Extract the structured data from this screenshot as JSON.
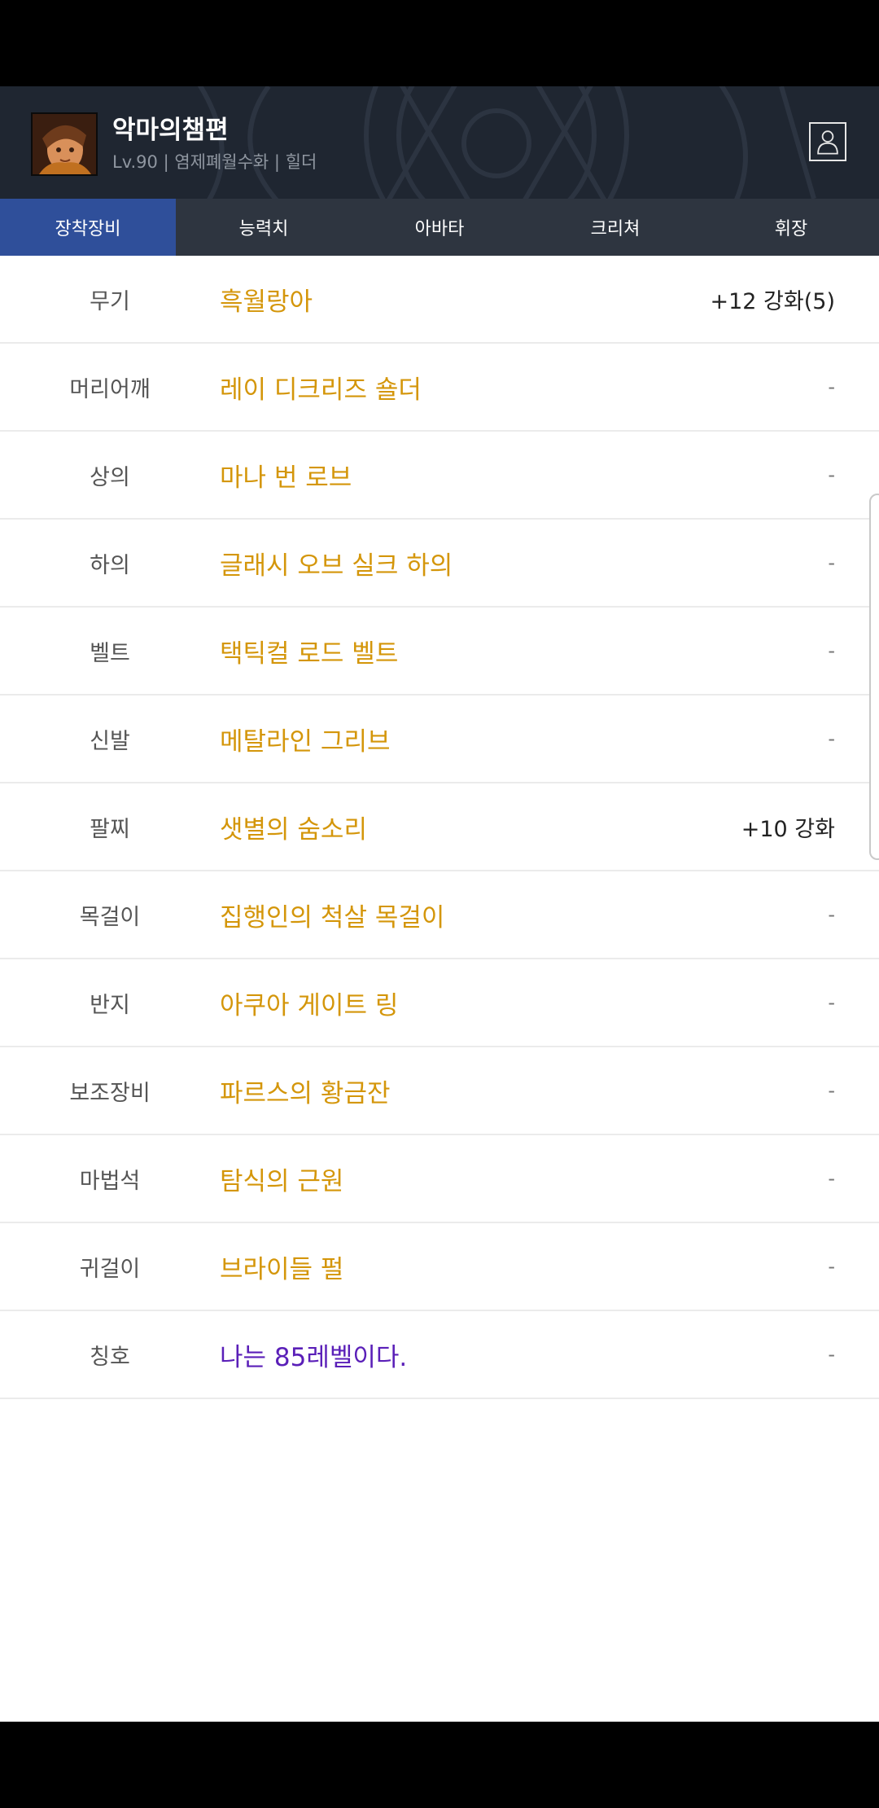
{
  "header": {
    "character_name": "악마의챔편",
    "subtitle": "Lv.90 | 염제폐월수화 | 힐더"
  },
  "tabs": [
    {
      "label": "장착장비",
      "active": true
    },
    {
      "label": "능력치",
      "active": false
    },
    {
      "label": "아바타",
      "active": false
    },
    {
      "label": "크리쳐",
      "active": false
    },
    {
      "label": "휘장",
      "active": false
    }
  ],
  "equipment": [
    {
      "slot": "무기",
      "item": "흑월랑아",
      "enhance": "+12 강화(5)"
    },
    {
      "slot": "머리어깨",
      "item": "레이 디크리즈 숄더",
      "enhance": "-"
    },
    {
      "slot": "상의",
      "item": "마나 번 로브",
      "enhance": "-"
    },
    {
      "slot": "하의",
      "item": "글래시 오브 실크 하의",
      "enhance": "-"
    },
    {
      "slot": "벨트",
      "item": "택틱컬 로드 벨트",
      "enhance": "-"
    },
    {
      "slot": "신발",
      "item": "메탈라인 그리브",
      "enhance": "-"
    },
    {
      "slot": "팔찌",
      "item": "샛별의 숨소리",
      "enhance": "+10 강화"
    },
    {
      "slot": "목걸이",
      "item": "집행인의 척살 목걸이",
      "enhance": "-"
    },
    {
      "slot": "반지",
      "item": "아쿠아 게이트 링",
      "enhance": "-"
    },
    {
      "slot": "보조장비",
      "item": "파르스의 황금잔",
      "enhance": "-"
    },
    {
      "slot": "마법석",
      "item": "탐식의 근원",
      "enhance": "-"
    },
    {
      "slot": "귀걸이",
      "item": "브라이들 펄",
      "enhance": "-"
    },
    {
      "slot": "칭호",
      "item": "나는 85레벨이다.",
      "enhance": "-"
    }
  ],
  "colors": {
    "item_gold": "#d4960a",
    "title_purple": "#5a1fb8",
    "active_tab": "#2f4f9a",
    "tab_bar": "#2e3540",
    "header_bg": "#1f2631"
  },
  "icons": {
    "avatar": "character-portrait",
    "profile": "user-profile-icon"
  }
}
